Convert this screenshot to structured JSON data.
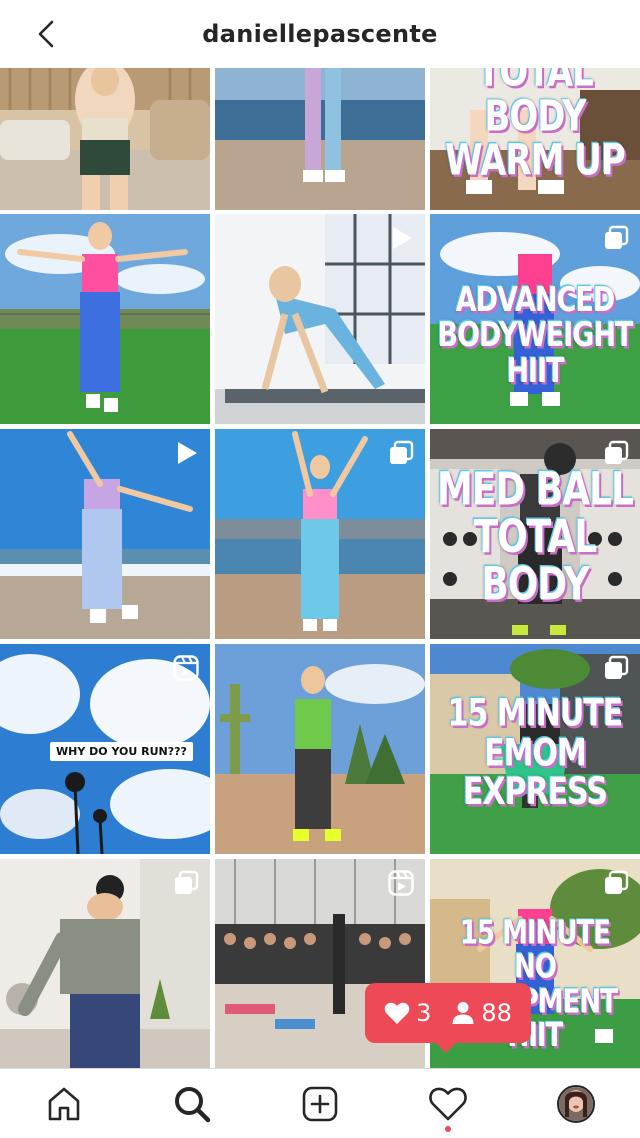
{
  "header": {
    "title": "daniellepascente",
    "back_icon": "chevron-left-icon"
  },
  "grid": {
    "tiles": [
      {
        "type": "image",
        "overlay": "",
        "caption": ""
      },
      {
        "type": "image",
        "overlay": "",
        "caption": ""
      },
      {
        "type": "image",
        "overlay": "TOTAL BODY\nWARM UP",
        "caption": ""
      },
      {
        "type": "image",
        "overlay": "",
        "caption": ""
      },
      {
        "type": "video",
        "overlay": "",
        "caption": ""
      },
      {
        "type": "carousel",
        "overlay": "ADVANCED\nBODYWEIGHT HIIT",
        "caption": ""
      },
      {
        "type": "video",
        "overlay": "",
        "caption": ""
      },
      {
        "type": "carousel",
        "overlay": "",
        "caption": ""
      },
      {
        "type": "carousel",
        "overlay": "MED BALL\nTOTAL BODY",
        "caption": ""
      },
      {
        "type": "reel",
        "overlay": "",
        "caption": "WHY DO YOU RUN???"
      },
      {
        "type": "image",
        "overlay": "",
        "caption": ""
      },
      {
        "type": "carousel",
        "overlay": "15 MINUTE\nEMOM EXPRESS",
        "caption": ""
      },
      {
        "type": "carousel",
        "overlay": "",
        "caption": ""
      },
      {
        "type": "reel",
        "overlay": "",
        "caption": ""
      },
      {
        "type": "carousel",
        "overlay": "15 MINUTE\nNO EQUIPMENT HIIT",
        "caption": ""
      }
    ]
  },
  "notification": {
    "likes": "3",
    "followers": "88",
    "color": "#ed4956"
  },
  "nav": {
    "items": [
      {
        "name": "home",
        "icon": "home-icon"
      },
      {
        "name": "search",
        "icon": "search-icon",
        "active": true
      },
      {
        "name": "new-post",
        "icon": "add-post-icon"
      },
      {
        "name": "activity",
        "icon": "heart-icon",
        "has_dot": true
      },
      {
        "name": "profile",
        "icon": "profile-avatar"
      }
    ]
  }
}
